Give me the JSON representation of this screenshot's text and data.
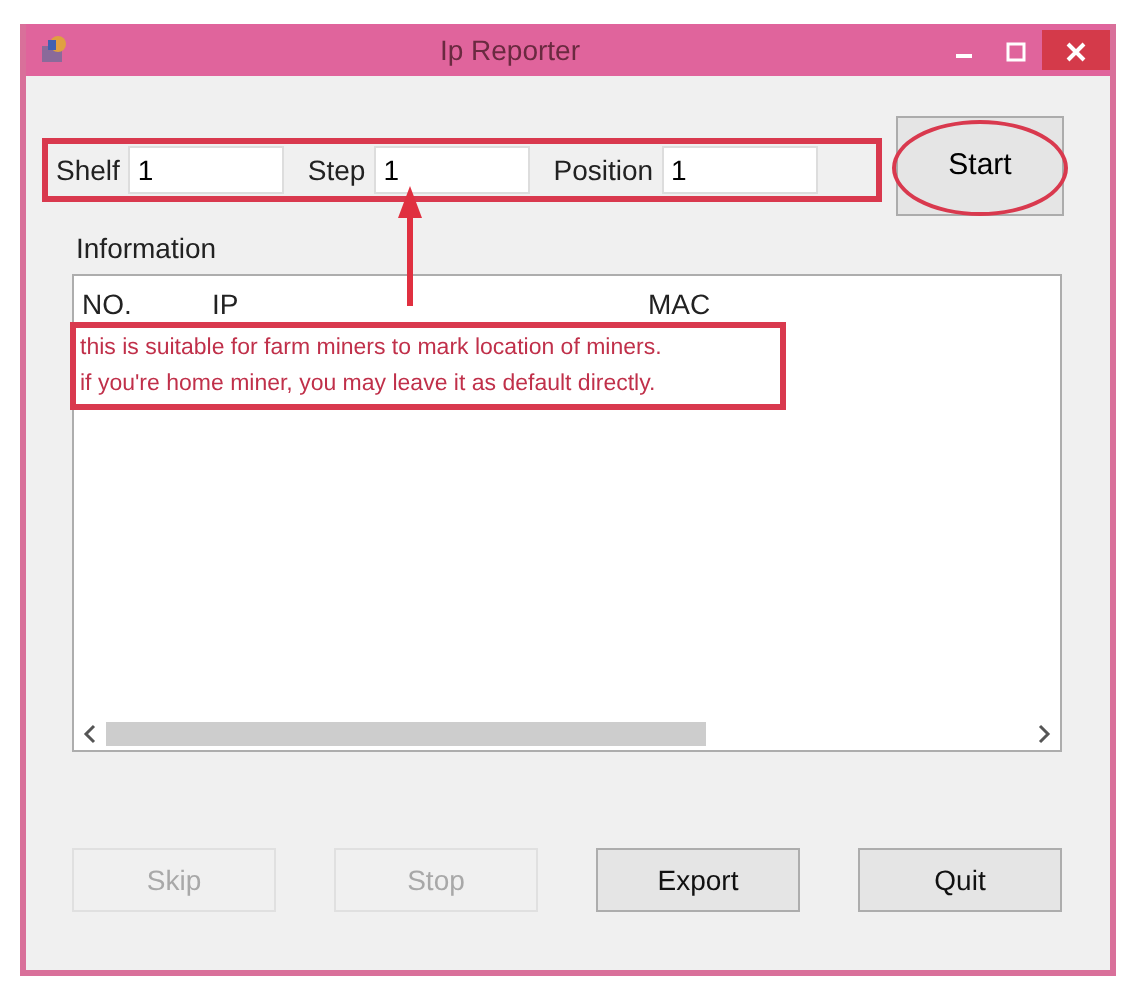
{
  "window": {
    "title": "Ip Reporter"
  },
  "fields": [
    {
      "label": "Shelf",
      "value": "1"
    },
    {
      "label": "Step",
      "value": "1"
    },
    {
      "label": "Position",
      "value": "1"
    }
  ],
  "start_button": {
    "label": "Start"
  },
  "information": {
    "label": "Information",
    "columns": [
      "NO.",
      "IP",
      "MAC"
    ]
  },
  "annotation": {
    "lines": [
      "this is suitable for farm miners to mark location of miners.",
      "if you're home miner, you may leave it as default directly."
    ]
  },
  "buttons": [
    {
      "label": "Skip",
      "disabled": true
    },
    {
      "label": "Stop",
      "disabled": true
    },
    {
      "label": "Export",
      "disabled": false
    },
    {
      "label": "Quit",
      "disabled": false
    }
  ]
}
